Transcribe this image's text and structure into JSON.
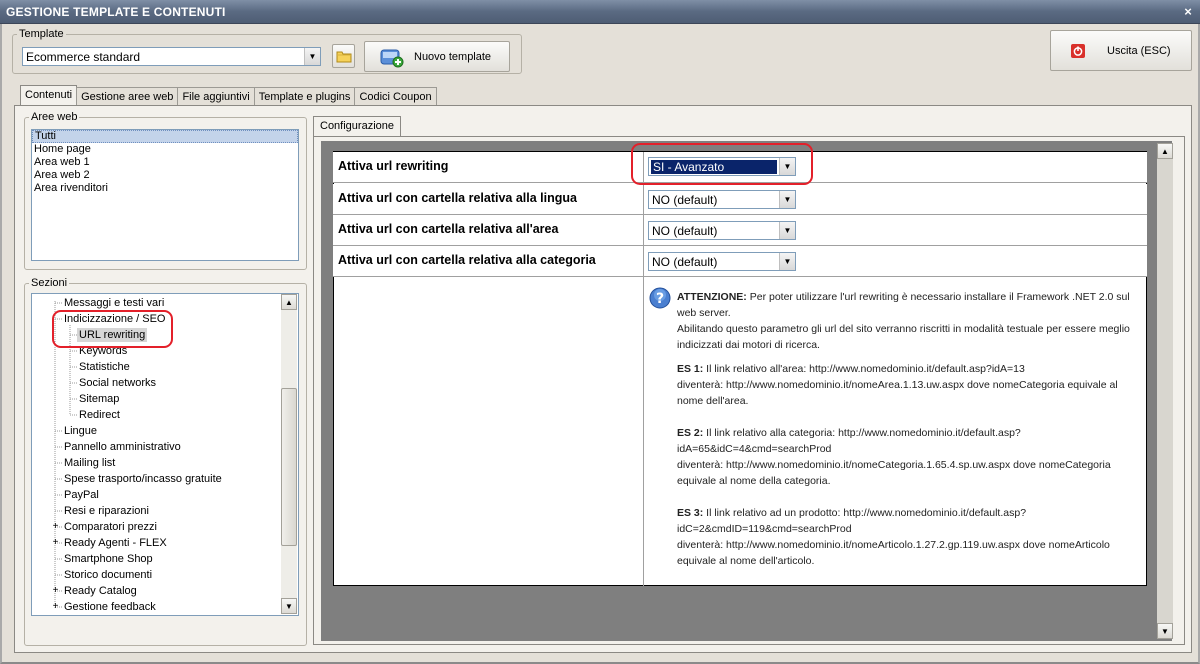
{
  "window": {
    "title": "GESTIONE TEMPLATE E CONTENUTI",
    "close": "×"
  },
  "template": {
    "legend": "Template",
    "selected": "Ecommerce standard",
    "new_button": "Nuovo template"
  },
  "exit_button": "Uscita (ESC)",
  "main_tabs": [
    "Contenuti",
    "Gestione aree web",
    "File aggiuntivi",
    "Template e plugins",
    "Codici Coupon"
  ],
  "aree_web": {
    "legend": "Aree web",
    "items": [
      "Tutti",
      "Home page",
      "Area web 1",
      "Area web 2",
      "Area rivenditori"
    ]
  },
  "sezioni": {
    "legend": "Sezioni",
    "items": [
      "Messaggi e testi vari",
      "Indicizzazione / SEO",
      "URL rewriting",
      "Keywords",
      "Statistiche",
      "Social networks",
      "Sitemap",
      "Redirect",
      "Lingue",
      "Pannello amministrativo",
      "Mailing list",
      "Spese trasporto/incasso gratuite",
      "PayPal",
      "Resi e riparazioni",
      "Comparatori prezzi",
      "Ready Agenti - FLEX",
      "Smartphone Shop",
      "Storico documenti",
      "Ready Catalog",
      "Gestione feedback"
    ]
  },
  "config_tab": "Configurazione",
  "config_rows": [
    {
      "label": "Attiva url rewriting",
      "value": "SI - Avanzato"
    },
    {
      "label": "Attiva url con cartella relativa alla lingua",
      "value": "NO (default)"
    },
    {
      "label": "Attiva url con cartella relativa all'area",
      "value": "NO (default)"
    },
    {
      "label": "Attiva url con cartella relativa alla categoria",
      "value": "NO (default)"
    }
  ],
  "info": {
    "attention_label": "ATTENZIONE:",
    "attention_text": " Per poter utilizzare l'url rewriting è necessario installare il Framework .NET 2.0 sul web server.",
    "line2": "Abilitando questo parametro gli url del sito verranno riscritti in modalità testuale per essere meglio indicizzati dai motori di ricerca.",
    "es1_label": "ES 1:",
    "es1_text": " Il link relativo all'area: http://www.nomedominio.it/default.asp?idA=13",
    "es1_line2": "diventerà: http://www.nomedominio.it/nomeArea.1.13.uw.aspx dove nomeCategoria equivale al nome dell'area.",
    "es2_label": "ES 2:",
    "es2_text": " Il link relativo alla categoria: http://www.nomedominio.it/default.asp?idA=65&idC=4&cmd=searchProd",
    "es2_line2": "diventerà: http://www.nomedominio.it/nomeCategoria.1.65.4.sp.uw.aspx dove nomeCategoria equivale al nome della categoria.",
    "es3_label": "ES 3:",
    "es3_text": " Il link relativo ad un prodotto: http://www.nomedominio.it/default.asp?idC=2&cmdID=119&cmd=searchProd",
    "es3_line2": "diventerà: http://www.nomedominio.it/nomeArticolo.1.27.2.gp.119.uw.aspx dove nomeArticolo equivale al nome dell'articolo."
  }
}
